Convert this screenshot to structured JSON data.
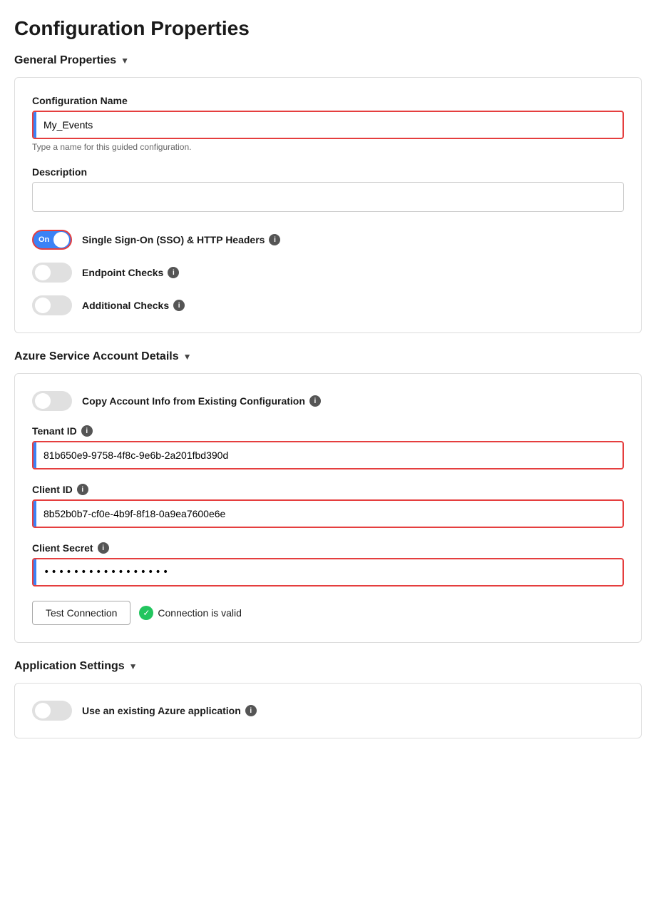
{
  "page": {
    "title": "Configuration Properties"
  },
  "general_properties": {
    "section_label": "General Properties",
    "config_name": {
      "label": "Configuration Name",
      "value": "My_Events",
      "hint": "Type a name for this guided configuration."
    },
    "description": {
      "label": "Description",
      "value": ""
    },
    "sso_toggle": {
      "label": "Single Sign-On (SSO) & HTTP Headers",
      "state": "On",
      "is_on": true
    },
    "endpoint_checks": {
      "label": "Endpoint Checks",
      "state": "Off",
      "is_on": false
    },
    "additional_checks": {
      "label": "Additional Checks",
      "state": "Off",
      "is_on": false
    }
  },
  "azure_section": {
    "section_label": "Azure Service Account Details",
    "copy_account_toggle": {
      "label": "Copy Account Info from Existing Configuration",
      "is_on": false
    },
    "tenant_id": {
      "label": "Tenant ID",
      "value": "81b650e9-9758-4f8c-9e6b-2a201fbd390d"
    },
    "client_id": {
      "label": "Client ID",
      "value": "8b52b0b7-cf0e-4b9f-8f18-0a9ea7600e6e"
    },
    "client_secret": {
      "label": "Client Secret",
      "value": "••••••••••••••••••••••••••••"
    },
    "test_button": "Test Connection",
    "connection_status": "Connection is valid"
  },
  "application_settings": {
    "section_label": "Application Settings",
    "use_existing_toggle": {
      "label": "Use an existing Azure application",
      "is_on": false
    }
  },
  "icons": {
    "info": "i",
    "check": "✓",
    "chevron": "▼"
  }
}
